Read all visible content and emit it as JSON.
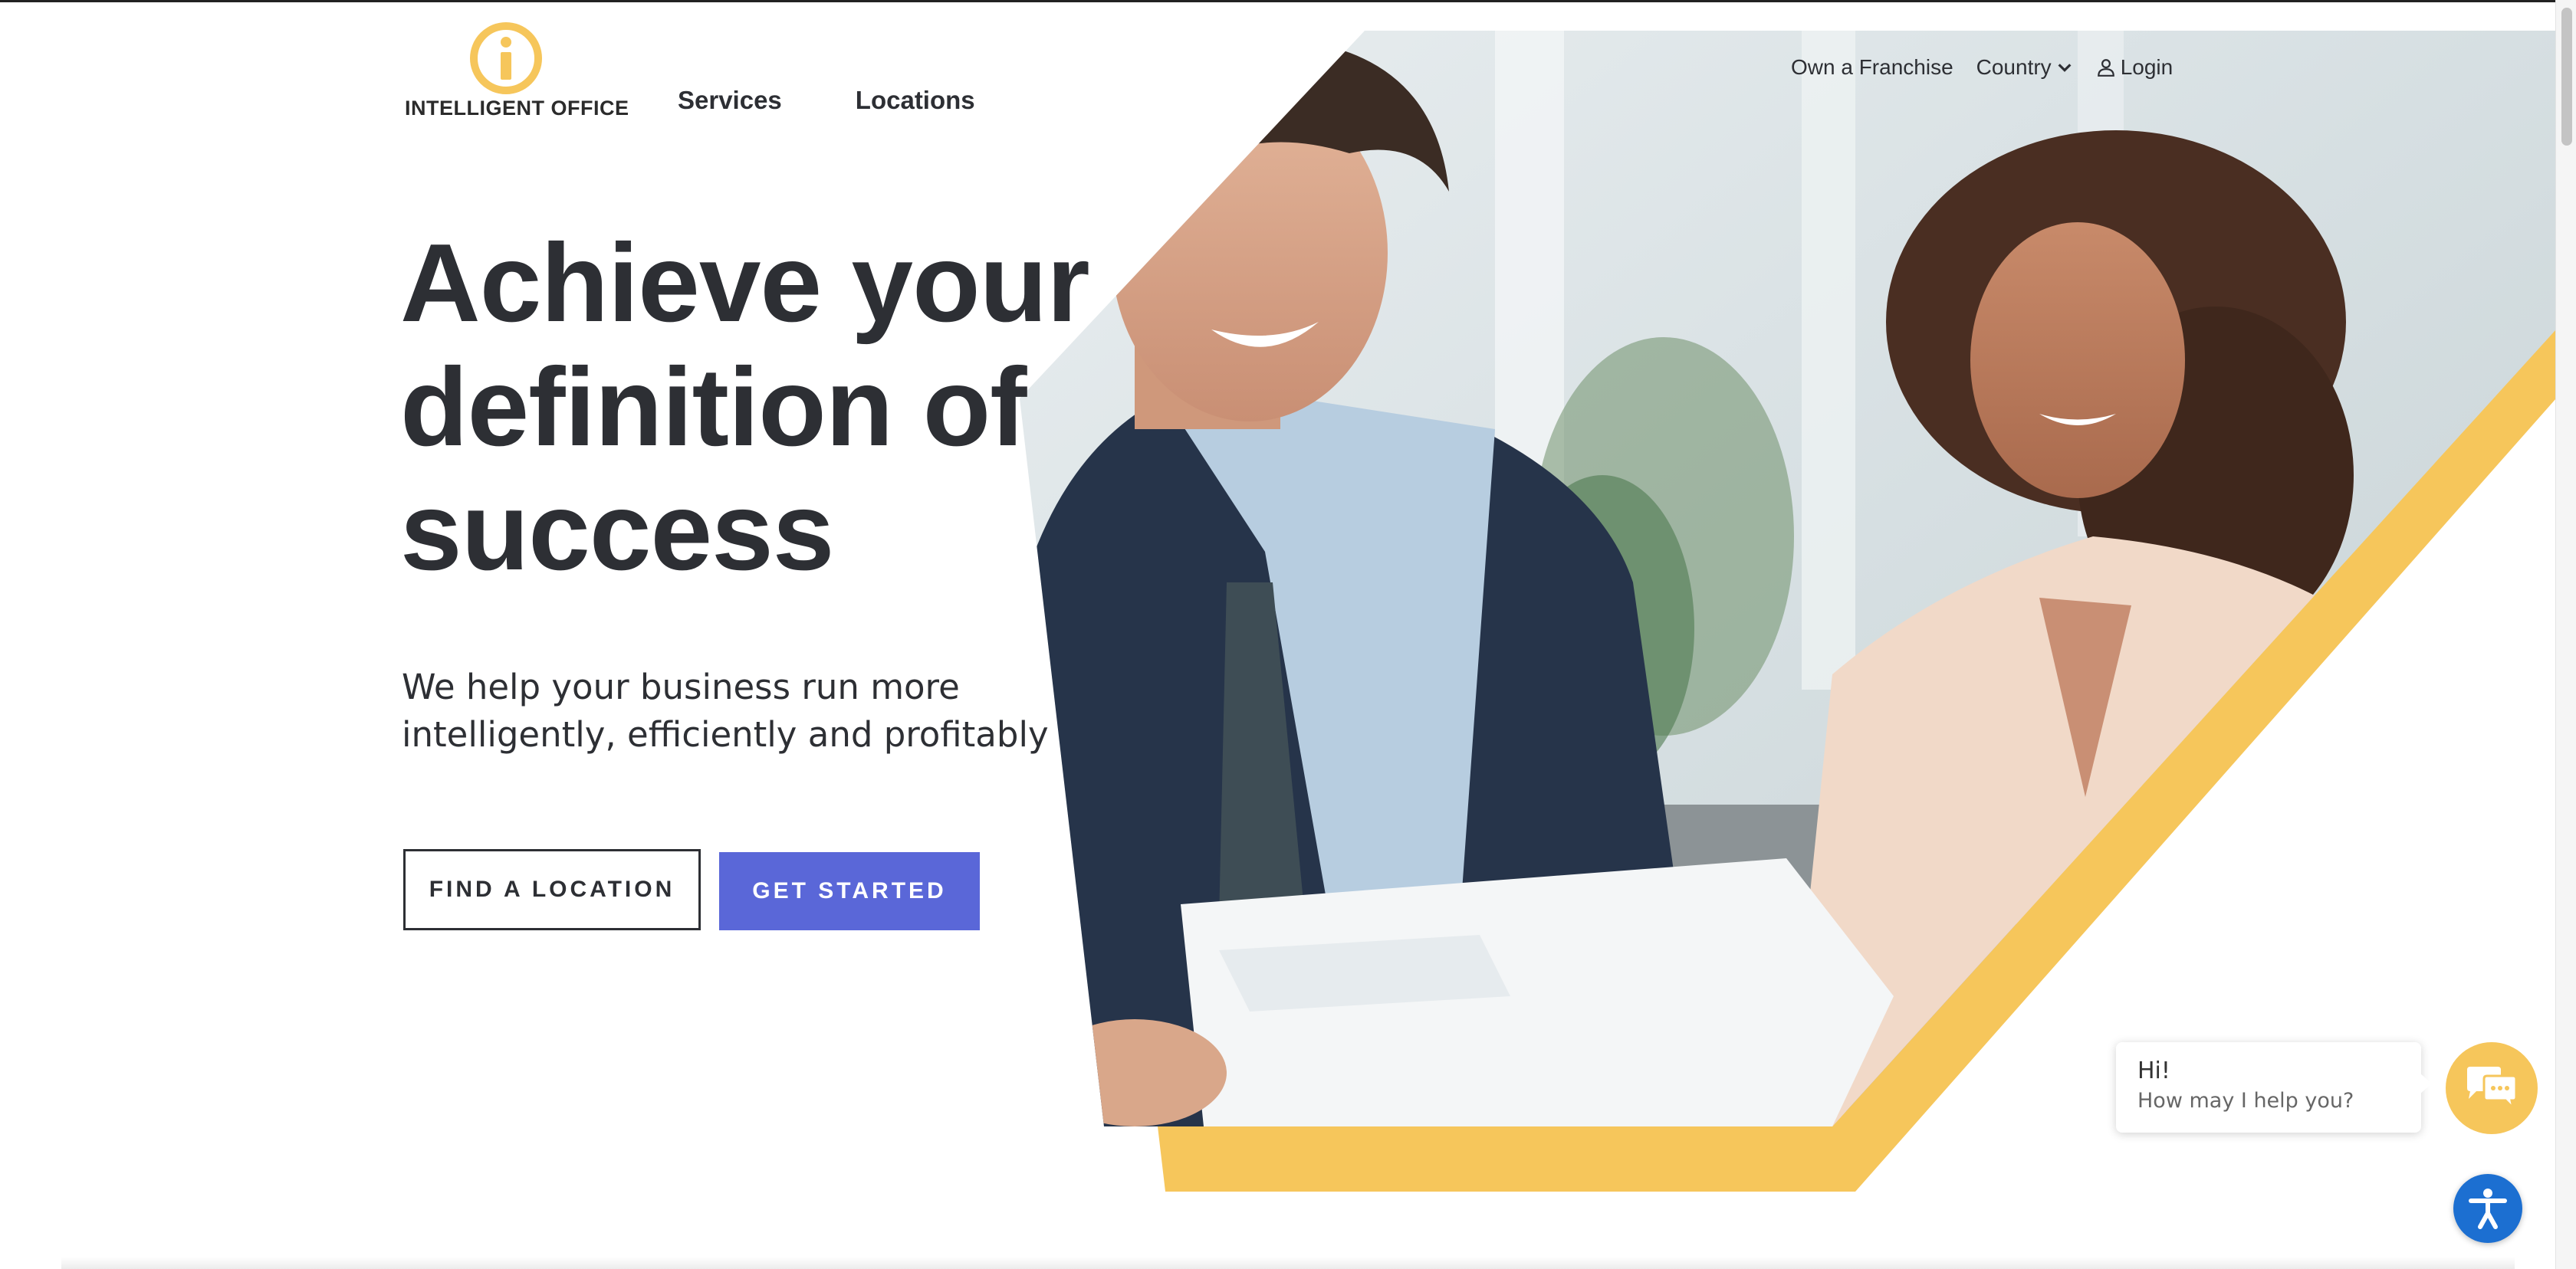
{
  "brand": {
    "name": "INTELLIGENT OFFICE",
    "accent": "#f6c65b"
  },
  "nav": {
    "services": "Services",
    "locations": "Locations"
  },
  "utility": {
    "franchise": "Own a Franchise",
    "country": "Country",
    "login": "Login"
  },
  "hero": {
    "line1": "Achieve your",
    "line2": "definition of",
    "line3": "success",
    "subline1": "We help your business run more",
    "subline2": "intelligently, efficiently and profitably",
    "cta_find": "FIND A LOCATION",
    "cta_start": "GET STARTED",
    "primary_color": "#5a67d8"
  },
  "chat": {
    "greeting": "Hi!",
    "prompt": "How may I help you?"
  },
  "icons": [
    "info-logo-icon",
    "chevron-down-icon",
    "user-icon",
    "chat-icon",
    "accessibility-icon"
  ]
}
